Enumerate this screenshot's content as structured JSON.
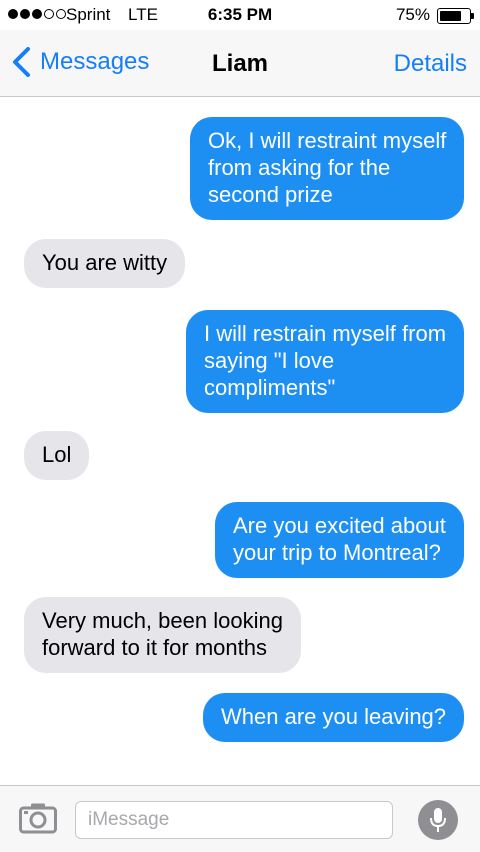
{
  "status_bar": {
    "signal_bars_filled": 3,
    "signal_bars_total": 5,
    "carrier": "Sprint",
    "network": "LTE",
    "time": "6:35 PM",
    "battery_percent_label": "75%",
    "battery_level": 0.75
  },
  "nav": {
    "back_label": "Messages",
    "title": "Liam",
    "details_label": "Details"
  },
  "messages": [
    {
      "direction": "sent",
      "lines": [
        "Ok, I will restraint myself",
        "from asking for the",
        "second prize"
      ]
    },
    {
      "direction": "received",
      "lines": [
        "You are witty"
      ]
    },
    {
      "direction": "sent",
      "lines": [
        "I will restrain myself from",
        "saying \"I love",
        "compliments\""
      ]
    },
    {
      "direction": "received",
      "lines": [
        "Lol"
      ]
    },
    {
      "direction": "sent",
      "lines": [
        "Are you excited about",
        "your trip to Montreal?"
      ]
    },
    {
      "direction": "received",
      "lines": [
        "Very much, been looking",
        "forward to it for months"
      ]
    },
    {
      "direction": "sent",
      "lines": [
        "When are you leaving?"
      ]
    }
  ],
  "input_bar": {
    "placeholder": "iMessage",
    "camera_icon": "camera-icon",
    "mic_icon": "microphone-icon"
  },
  "colors": {
    "accent": "#157efb",
    "sent_bubble": "#1d8ff3",
    "received_bubble": "#e5e5ea",
    "mic_button": "#8e8e93"
  }
}
